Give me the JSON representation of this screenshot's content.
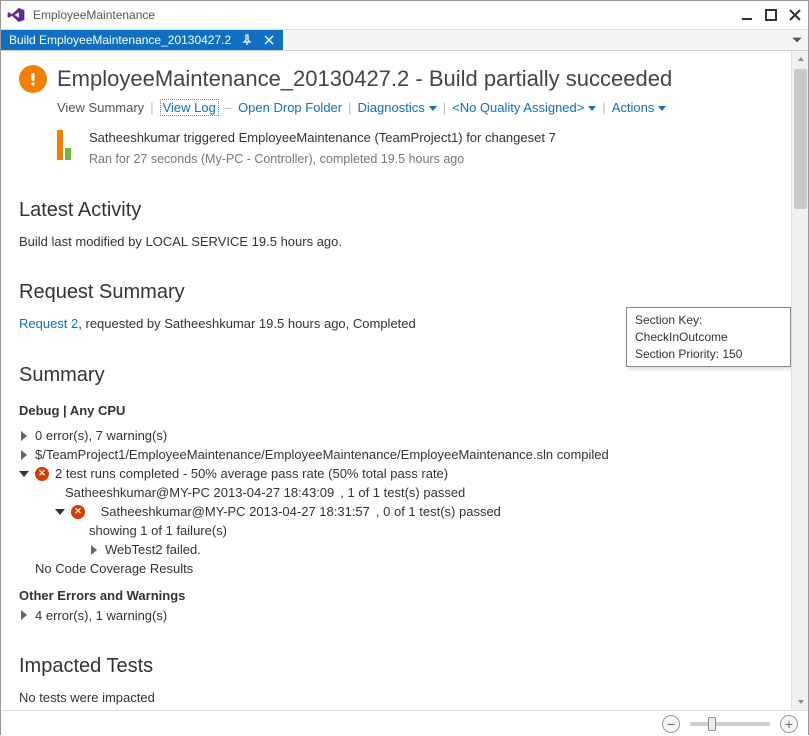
{
  "window": {
    "title": "EmployeeMaintenance"
  },
  "tab": {
    "label": "Build EmployeeMaintenance_20130427.2"
  },
  "header": {
    "title": "EmployeeMaintenance_20130427.2 - Build partially succeeded"
  },
  "actions": {
    "view_summary": "View Summary",
    "view_log": "View Log",
    "open_drop": "Open Drop Folder",
    "diagnostics": "Diagnostics",
    "quality": "<No Quality Assigned>",
    "more": "Actions"
  },
  "trigger": {
    "line1": "Satheeshkumar triggered EmployeeMaintenance (TeamProject1) for changeset 7",
    "line2": "Ran for 27 seconds (My-PC - Controller), completed 19.5 hours ago"
  },
  "sections": {
    "latest_activity": "Latest Activity",
    "latest_activity_body": "Build last modified by LOCAL SERVICE 19.5 hours ago.",
    "request_summary": "Request Summary",
    "request_link": "Request 2",
    "request_rest": ", requested by Satheeshkumar 19.5 hours ago, Completed",
    "summary": "Summary",
    "impacted": "Impacted Tests",
    "impacted_body": "No tests were impacted"
  },
  "summary": {
    "config": "Debug | Any CPU",
    "errors": "0 error(s), 7 warning(s)",
    "compiled": "$/TeamProject1/EmployeeMaintenance/EmployeeMaintenance/EmployeeMaintenance.sln compiled",
    "testruns": "2 test runs completed - 50% average pass rate (50% total pass rate)",
    "run1_link": "Satheeshkumar@MY-PC 2013-04-27 18:43:09",
    "run1_rest": ", 1 of 1 test(s) passed",
    "run2_link": "Satheeshkumar@MY-PC 2013-04-27 18:31:57",
    "run2_rest": ", 0 of 1 test(s) passed",
    "showing": "showing 1 of 1 failure(s)",
    "fail": "WebTest2 failed.",
    "nocov": "No Code Coverage Results",
    "other_hdr": "Other Errors and Warnings",
    "other_body": "4 error(s), 1 warning(s)"
  },
  "tooltip": {
    "line1": "Section Key: CheckInOutcome",
    "line2": "Section Priority: 150"
  }
}
